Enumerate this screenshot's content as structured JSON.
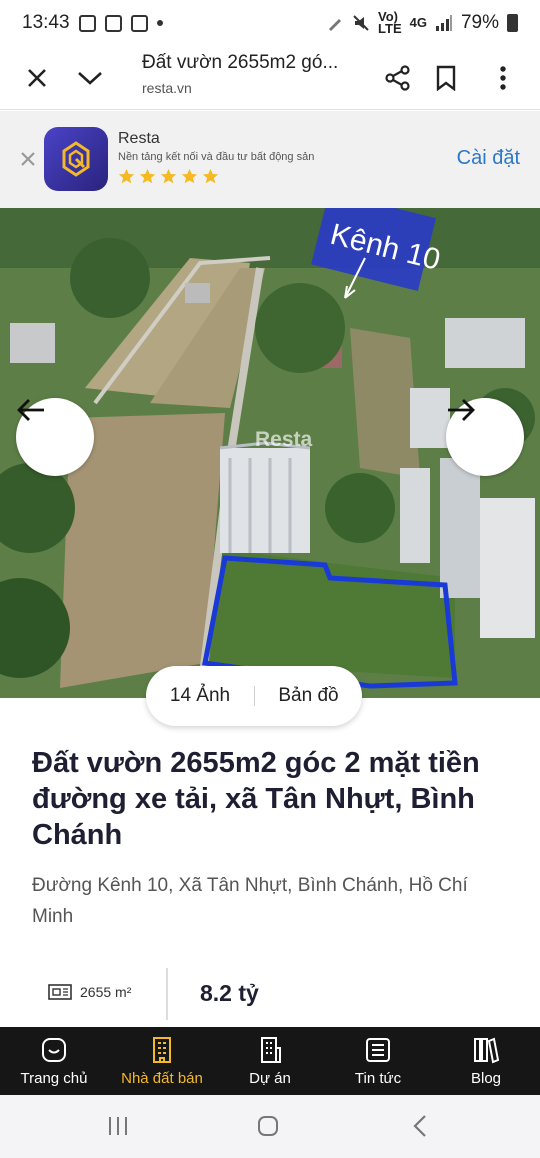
{
  "status_bar": {
    "time": "13:43",
    "battery": "79%",
    "network": "4G"
  },
  "header": {
    "title": "Đất vườn 2655m2 gó...",
    "url": "resta.vn"
  },
  "app_banner": {
    "app_name": "Resta",
    "tagline": "Nền tảng kết nối và đầu tư bất động sản",
    "rating_stars": 5,
    "install_label": "Cài đặt"
  },
  "hero": {
    "image_overlay_label": "Kênh 10",
    "watermark": "Resta",
    "photos_label": "14 Ảnh",
    "map_label": "Bản đồ"
  },
  "listing": {
    "title": "Đất vườn 2655m2 góc 2 mặt tiền đường xe tải, xã Tân Nhựt, Bình Chánh",
    "address": "Đường Kênh 10, Xã Tân Nhựt, Bình Chánh, Hồ Chí Minh",
    "area": "2655 m²",
    "price": "8.2 tỷ"
  },
  "bottom_nav": [
    {
      "label": "Trang chủ",
      "icon": "home-icon",
      "active": false
    },
    {
      "label": "Nhà đất bán",
      "icon": "building-icon",
      "active": true
    },
    {
      "label": "Dự án",
      "icon": "project-icon",
      "active": false
    },
    {
      "label": "Tin tức",
      "icon": "news-icon",
      "active": false
    },
    {
      "label": "Blog",
      "icon": "books-icon",
      "active": false
    }
  ],
  "colors": {
    "accent": "#f3b928",
    "install_blue": "#2a78c9",
    "star_yellow": "#f5b921",
    "nav_bg": "#161616"
  }
}
